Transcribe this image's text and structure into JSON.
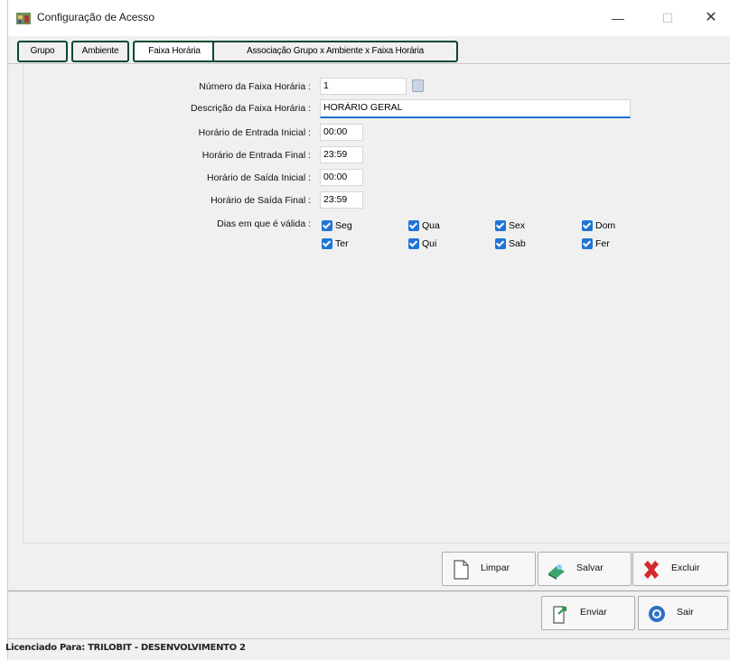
{
  "window": {
    "title": "Configuração de Acesso",
    "icon": "app-config-icon",
    "minimize": "—",
    "maximize": "☐",
    "close": "✕"
  },
  "tabs": [
    {
      "label": "Grupo",
      "active": false
    },
    {
      "label": "Ambiente",
      "active": false
    },
    {
      "label": "Faixa Horária",
      "active": true
    },
    {
      "label": "Associação Grupo x Ambiente x Faixa Horária",
      "active": false
    }
  ],
  "form": {
    "numero_label": "Número da Faixa Horária :",
    "numero_value": "1",
    "descricao_label": "Descrição da Faixa Horária :",
    "descricao_value": "HORÁRIO GERAL",
    "entrada_inicial_label": "Horário de Entrada Inicial :",
    "entrada_inicial_value": "00:00",
    "entrada_final_label": "Horário de Entrada Final :",
    "entrada_final_value": "23:59",
    "saida_inicial_label": "Horário de Saída Inicial :",
    "saida_inicial_value": "00:00",
    "saida_final_label": "Horário de Saída Final :",
    "saida_final_value": "23:59",
    "dias_label": "Dias em que é válida :",
    "dias": [
      {
        "label": "Seg",
        "checked": true
      },
      {
        "label": "Qua",
        "checked": true
      },
      {
        "label": "Sex",
        "checked": true
      },
      {
        "label": "Dom",
        "checked": true
      },
      {
        "label": "Ter",
        "checked": true
      },
      {
        "label": "Qui",
        "checked": true
      },
      {
        "label": "Sab",
        "checked": true
      },
      {
        "label": "Fer",
        "checked": true
      }
    ]
  },
  "actions": {
    "limpar": "Limpar",
    "salvar": "Salvar",
    "excluir": "Excluir",
    "enviar": "Enviar",
    "sair": "Sair"
  },
  "status": "Licenciado Para: TRILOBIT - DESENVOLVIMENTO 2",
  "colors": {
    "tab_outline": "#06492f",
    "checkbox": "#1e75d6",
    "focus_underline": "#1e6ed6"
  }
}
